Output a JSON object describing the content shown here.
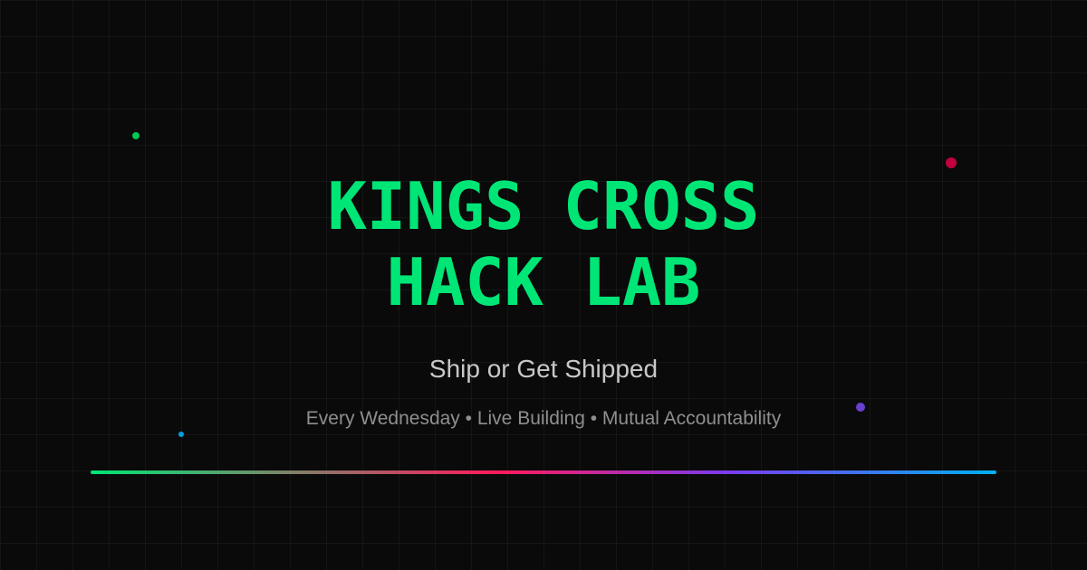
{
  "title": {
    "line1": "KINGS CROSS",
    "line2": "HACK LAB"
  },
  "tagline": "Ship or Get Shipped",
  "details": "Every Wednesday • Live Building • Mutual Accountability",
  "colors": {
    "accent": "#00e676",
    "background": "#0a0a0a",
    "dot_green": "#00c853",
    "dot_red": "#c2003f",
    "dot_purple": "#6a3fd0",
    "dot_blue": "#00a0e0"
  }
}
